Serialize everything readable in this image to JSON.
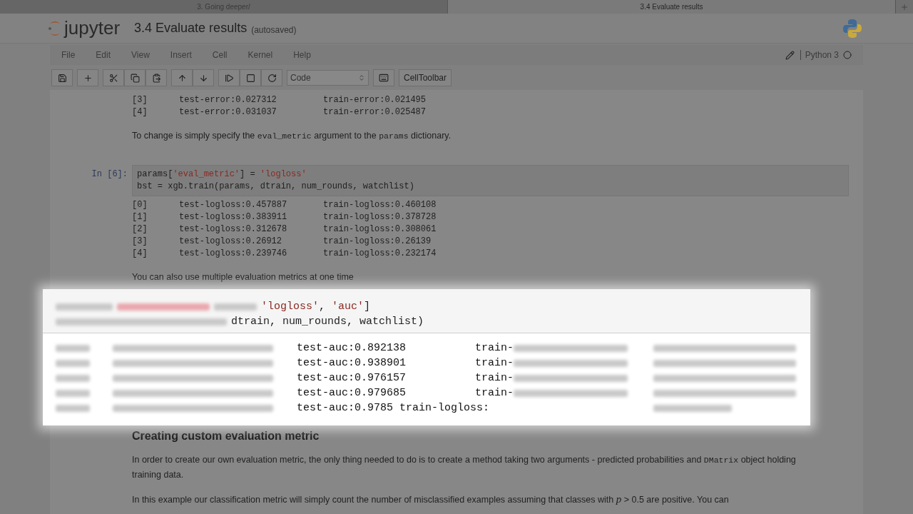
{
  "browser_tabs": [
    {
      "label": "3. Going deeper/",
      "selected": false
    },
    {
      "label": "3.4 Evaluate results",
      "selected": true
    }
  ],
  "header": {
    "logo": "jupyter",
    "title": "3.4 Evaluate results",
    "status": "(autosaved)"
  },
  "menu": [
    "File",
    "Edit",
    "View",
    "Insert",
    "Cell",
    "Kernel",
    "Help"
  ],
  "kernel": "Python 3",
  "toolbar": {
    "cell_type": "Code",
    "cell_toolbar": "CellToolbar"
  },
  "cells": [
    {
      "kind": "output",
      "rows": [
        [
          "[3]",
          "test-error:0.027312",
          "train-error:0.021495"
        ],
        [
          "[4]",
          "test-error:0.031037",
          "train-error:0.025487"
        ]
      ]
    },
    {
      "kind": "markdown",
      "paragraphs": [
        [
          {
            "kind": "text",
            "text": "To change is simply specify the "
          },
          {
            "kind": "code",
            "text": "eval_metric"
          },
          {
            "kind": "text",
            "text": " argument to the "
          },
          {
            "kind": "code",
            "text": "params"
          },
          {
            "kind": "text",
            "text": " dictionary."
          }
        ]
      ]
    },
    {
      "kind": "code",
      "prompt": "In [6]:",
      "lines": [
        [
          {
            "kind": "plain",
            "text": "params["
          },
          {
            "kind": "string",
            "text": "'eval_metric'"
          },
          {
            "kind": "plain",
            "text": "] = "
          },
          {
            "kind": "string",
            "text": "'logloss'"
          }
        ],
        [
          {
            "kind": "plain",
            "text": "bst = xgb.train(params, dtrain, num_rounds, watchlist)"
          }
        ]
      ]
    },
    {
      "kind": "output",
      "rows": [
        [
          "[0]",
          "test-logloss:0.457887",
          "train-logloss:0.460108"
        ],
        [
          "[1]",
          "test-logloss:0.383911",
          "train-logloss:0.378728"
        ],
        [
          "[2]",
          "test-logloss:0.312678",
          "train-logloss:0.308061"
        ],
        [
          "[3]",
          "test-logloss:0.26912",
          "train-logloss:0.26139"
        ],
        [
          "[4]",
          "test-logloss:0.239746",
          "train-logloss:0.232174"
        ]
      ]
    },
    {
      "kind": "markdown",
      "paragraphs": [
        [
          {
            "kind": "text",
            "text": "You can also use multiple evaluation metrics at one time"
          }
        ]
      ]
    },
    {
      "kind": "covered"
    },
    {
      "kind": "heading",
      "text": "Creating custom evaluation metric"
    },
    {
      "kind": "markdown",
      "paragraphs": [
        [
          {
            "kind": "text",
            "text": "In order to create our own evaluation metric, the only thing needed to do is to create a method taking two arguments - predicted probabilities and "
          },
          {
            "kind": "code",
            "text": "DMatrix"
          },
          {
            "kind": "text",
            "text": " object holding training data."
          }
        ],
        [
          {
            "kind": "text",
            "text": "In this example our classification metric will simply count the number of misclassified examples assuming that classes with "
          },
          {
            "kind": "math",
            "text": "p"
          },
          {
            "kind": "text",
            "text": " > 0.5 are positive. You can"
          }
        ]
      ]
    }
  ],
  "zoom_overlay": {
    "code_lines": [
      [
        {
          "kind": "string",
          "text": "'logloss'"
        },
        {
          "kind": "plain",
          "text": ", "
        },
        {
          "kind": "string",
          "text": "'auc'"
        },
        {
          "kind": "plain",
          "text": "]"
        }
      ],
      [
        {
          "kind": "plain",
          "text": "dtrain, num_rounds, watchlist)"
        }
      ]
    ],
    "output_rows": [
      {
        "auc": "test-auc:0.892138",
        "train": "train-"
      },
      {
        "auc": "test-auc:0.938901",
        "train": "train-"
      },
      {
        "auc": "test-auc:0.976157",
        "train": "train-"
      },
      {
        "auc": "test-auc:0.979685",
        "train": "train-"
      },
      {
        "auc": "test-auc:0.9785 train-logloss:"
      }
    ]
  }
}
